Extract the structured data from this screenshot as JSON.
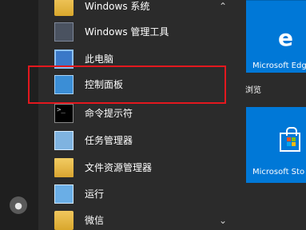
{
  "start_menu": {
    "user_icon": "user-icon",
    "items": [
      {
        "label": "Windows 系统",
        "icon": "folder-icon",
        "expanded": true
      },
      {
        "label": "Windows 管理工具",
        "icon": "admin-tools-icon"
      },
      {
        "label": "此电脑",
        "icon": "this-pc-icon"
      },
      {
        "label": "控制面板",
        "icon": "control-panel-icon"
      },
      {
        "label": "命令提示符",
        "icon": "command-prompt-icon"
      },
      {
        "label": "任务管理器",
        "icon": "task-manager-icon"
      },
      {
        "label": "文件资源管理器",
        "icon": "file-explorer-icon"
      },
      {
        "label": "运行",
        "icon": "run-icon"
      },
      {
        "label": "微信",
        "icon": "folder-icon",
        "expanded": false
      }
    ]
  },
  "tiles": {
    "edge_label": "Microsoft Edg",
    "browse_label": "浏览",
    "store_label": "Microsoft Sto"
  },
  "colors": {
    "highlight": "#e3181e",
    "tile": "#0078d7"
  }
}
